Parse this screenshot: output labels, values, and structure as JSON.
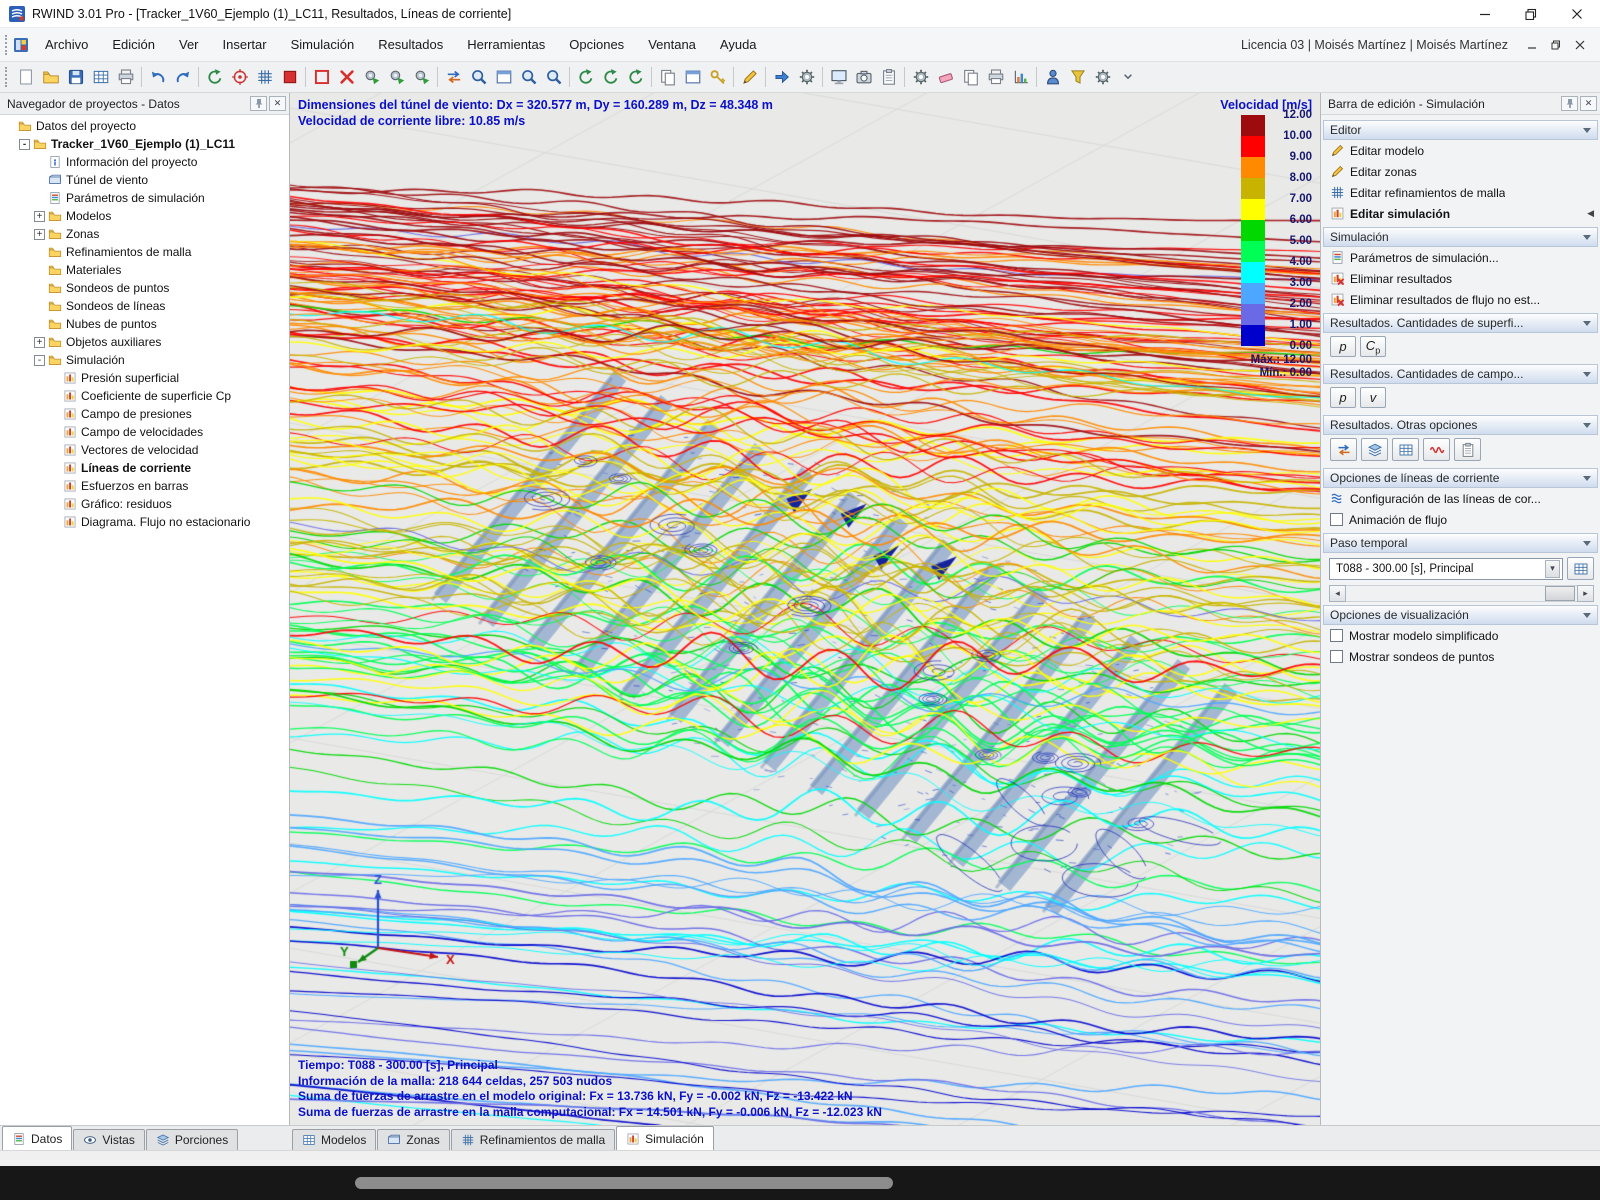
{
  "window": {
    "title": "RWIND 3.01 Pro - [Tracker_1V60_Ejemplo (1)_LC11, Resultados, Líneas de corriente]",
    "license": "Licencia 03 | Moisés Martínez | Moisés Martínez"
  },
  "menu": {
    "items": [
      "Archivo",
      "Edición",
      "Ver",
      "Insertar",
      "Simulación",
      "Resultados",
      "Herramientas",
      "Opciones",
      "Ventana",
      "Ayuda"
    ]
  },
  "toolbar": {
    "items": [
      {
        "name": "new-project",
        "kind": "page"
      },
      {
        "name": "open-project",
        "kind": "folder"
      },
      {
        "name": "save-project",
        "kind": "floppy"
      },
      {
        "name": "project-tables",
        "kind": "grid"
      },
      {
        "name": "print",
        "kind": "printer"
      },
      {
        "sep": true
      },
      {
        "name": "undo",
        "kind": "undo"
      },
      {
        "name": "redo",
        "kind": "redo"
      },
      {
        "sep": true
      },
      {
        "name": "regenerate-model",
        "kind": "rotate"
      },
      {
        "name": "center-model",
        "kind": "target"
      },
      {
        "name": "mesh-settings",
        "kind": "mesh"
      },
      {
        "name": "stop-calculation",
        "kind": "stop"
      },
      {
        "sep": true
      },
      {
        "name": "wind-tunnel",
        "kind": "frame"
      },
      {
        "name": "delete-results",
        "kind": "xred"
      },
      {
        "name": "run-simulation",
        "kind": "gearplay"
      },
      {
        "name": "run-mesh",
        "kind": "gearplay"
      },
      {
        "name": "run-batch",
        "kind": "gearplay"
      },
      {
        "sep": true
      },
      {
        "name": "swap-flow-direction",
        "kind": "swap"
      },
      {
        "name": "zoom-extents",
        "kind": "magnifier"
      },
      {
        "name": "zoom-window",
        "kind": "window"
      },
      {
        "name": "zoom-in",
        "kind": "magnifier"
      },
      {
        "name": "zoom-out",
        "kind": "magnifier"
      },
      {
        "sep": true
      },
      {
        "name": "rotate-view",
        "kind": "rotate"
      },
      {
        "name": "orbit-view",
        "kind": "rotate"
      },
      {
        "name": "spin-view",
        "kind": "rotate"
      },
      {
        "sep": true
      },
      {
        "name": "copy-graphic",
        "kind": "docs"
      },
      {
        "name": "new-window",
        "kind": "window"
      },
      {
        "name": "license-settings",
        "kind": "key"
      },
      {
        "sep": true
      },
      {
        "name": "annotate",
        "kind": "pen"
      },
      {
        "sep": true
      },
      {
        "name": "move-mode",
        "kind": "arrow"
      },
      {
        "name": "display-settings",
        "kind": "gear"
      },
      {
        "sep": true
      },
      {
        "name": "full-screen-graphic",
        "kind": "monitor"
      },
      {
        "name": "snapshot",
        "kind": "camera"
      },
      {
        "name": "export-graphic",
        "kind": "clipboard"
      },
      {
        "sep": true
      },
      {
        "name": "configuration",
        "kind": "gear"
      },
      {
        "name": "eraser",
        "kind": "eraser"
      },
      {
        "name": "duplicate",
        "kind": "docs"
      },
      {
        "name": "print-graphic",
        "kind": "printer"
      },
      {
        "name": "result-diagrams",
        "kind": "chart"
      },
      {
        "sep": true
      },
      {
        "name": "edit-user",
        "kind": "person"
      },
      {
        "name": "filter-results",
        "kind": "funnel"
      },
      {
        "name": "customize-toolbar",
        "kind": "gear"
      },
      {
        "name": "toolbar-overflow",
        "kind": "grip"
      }
    ]
  },
  "left_panel": {
    "title": "Navegador de proyectos - Datos",
    "tree": [
      {
        "label": "Datos del proyecto",
        "level": 0,
        "icon": "folder"
      },
      {
        "label": "Tracker_1V60_Ejemplo (1)_LC11",
        "level": 1,
        "icon": "folder",
        "bold": true,
        "expander": "minus"
      },
      {
        "label": "Información del proyecto",
        "level": 2,
        "icon": "info"
      },
      {
        "label": "Túnel de viento",
        "level": 2,
        "icon": "tunnel"
      },
      {
        "label": "Parámetros de simulación",
        "level": 2,
        "icon": "params"
      },
      {
        "label": "Modelos",
        "level": 2,
        "icon": "folder",
        "expander": "plus"
      },
      {
        "label": "Zonas",
        "level": 2,
        "icon": "folder",
        "expander": "plus"
      },
      {
        "label": "Refinamientos de malla",
        "level": 2,
        "icon": "folder"
      },
      {
        "label": "Materiales",
        "level": 2,
        "icon": "folder"
      },
      {
        "label": "Sondeos de puntos",
        "level": 2,
        "icon": "folder"
      },
      {
        "label": "Sondeos de líneas",
        "level": 2,
        "icon": "folder"
      },
      {
        "label": "Nubes de puntos",
        "level": 2,
        "icon": "folder"
      },
      {
        "label": "Objetos auxiliares",
        "level": 2,
        "icon": "folder",
        "expander": "plus"
      },
      {
        "label": "Simulación",
        "level": 2,
        "icon": "folder",
        "expander": "minus"
      },
      {
        "label": "Presión superficial",
        "level": 3,
        "icon": "bars"
      },
      {
        "label": "Coeficiente de superficie Cp",
        "level": 3,
        "icon": "bars"
      },
      {
        "label": "Campo de presiones",
        "level": 3,
        "icon": "bars"
      },
      {
        "label": "Campo de velocidades",
        "level": 3,
        "icon": "bars"
      },
      {
        "label": "Vectores de velocidad",
        "level": 3,
        "icon": "bars"
      },
      {
        "label": "Líneas de corriente",
        "level": 3,
        "icon": "bars",
        "bold": true,
        "selected": true
      },
      {
        "label": "Esfuerzos en barras",
        "level": 3,
        "icon": "bars"
      },
      {
        "label": "Gráfico: residuos",
        "level": 3,
        "icon": "bars"
      },
      {
        "label": "Diagrama. Flujo no estacionario",
        "level": 3,
        "icon": "bars"
      }
    ]
  },
  "viewport": {
    "header_line1": "Dimensiones del túnel de viento: Dx = 320.577 m, Dy = 160.289 m, Dz = 48.348 m",
    "header_line2": "Velocidad de corriente libre: 10.85 m/s",
    "legend": {
      "title": "Velocidad [m/s]",
      "values": [
        "12.00",
        "10.00",
        "9.00",
        "8.00",
        "7.00",
        "6.00",
        "5.00",
        "4.00",
        "3.00",
        "2.00",
        "1.00",
        "0.00"
      ],
      "colors": [
        "#9e0b0f",
        "#ff0000",
        "#ff8a00",
        "#c8b400",
        "#ffff00",
        "#00d800",
        "#00ff55",
        "#00ffff",
        "#4da6ff",
        "#6a6ae6",
        "#0000cd"
      ],
      "max_label": "Máx.: 12.00",
      "min_label": "Mín.: 0.00"
    },
    "footer_lines": [
      "Tiempo: T088 - 300.00 [s], Principal",
      "Información de la malla: 218 644 celdas, 257 503 nudos",
      "Suma de fuerzas de arrastre en el modelo original: Fx = 13.736 kN, Fy = -0.002 kN, Fz = -13.422 kN",
      "Suma de fuerzas de arrastre en la malla computacional: Fx = 14.501 kN, Fy = -0.006 kN, Fz = -12.023 kN"
    ],
    "axes": {
      "x": "X",
      "y": "Y",
      "z": "Z"
    }
  },
  "right_panel": {
    "title": "Barra de edición - Simulación",
    "sections": [
      {
        "title": "Editor",
        "items": [
          {
            "label": "Editar modelo",
            "icon": "pencil"
          },
          {
            "label": "Editar zonas",
            "icon": "pencil"
          },
          {
            "label": "Editar refinamientos de malla",
            "icon": "mesh"
          },
          {
            "label": "Editar simulación",
            "icon": "bars",
            "bold": true,
            "marker": true
          }
        ]
      },
      {
        "title": "Simulación",
        "items": [
          {
            "label": "Parámetros de simulación...",
            "icon": "params"
          },
          {
            "label": "Eliminar resultados",
            "icon": "del-red"
          },
          {
            "label": "Eliminar resultados de flujo no est...",
            "icon": "del-red"
          }
        ]
      },
      {
        "title": "Resultados. Cantidades de superfi...",
        "buttons": [
          {
            "label": "p",
            "name": "surface-pressure-button"
          },
          {
            "label": "Cp",
            "name": "surface-cp-button"
          }
        ]
      },
      {
        "title": "Resultados. Cantidades de campo...",
        "buttons": [
          {
            "label": "p",
            "name": "field-pressure-button"
          },
          {
            "label": "v",
            "name": "field-velocity-button"
          }
        ]
      },
      {
        "title": "Resultados. Otras opciones",
        "iconButtons": [
          {
            "name": "streamline-swap",
            "kind": "swap"
          },
          {
            "name": "section-planes",
            "kind": "layers"
          },
          {
            "name": "result-table",
            "kind": "grid"
          },
          {
            "name": "residual-wave",
            "kind": "wave-red"
          },
          {
            "name": "copy-results",
            "kind": "clipboard"
          }
        ]
      },
      {
        "title": "Opciones de líneas de corriente",
        "items": [
          {
            "label": "Configuración de las líneas de cor...",
            "icon": "stream"
          },
          {
            "label": "Animación de flujo",
            "checkbox": true,
            "checked": false
          }
        ]
      },
      {
        "title": "Paso temporal",
        "timestep": {
          "value": "T088 - 300.00 [s], Principal"
        }
      },
      {
        "title": "Opciones de visualización",
        "items": [
          {
            "label": "Mostrar modelo simplificado",
            "checkbox": true,
            "checked": false
          },
          {
            "label": "Mostrar sondeos de puntos",
            "checkbox": true,
            "checked": false
          }
        ]
      }
    ]
  },
  "bottom_tabs": {
    "left": [
      {
        "label": "Datos",
        "icon": "params",
        "active": true
      },
      {
        "label": "Vistas",
        "icon": "eye"
      },
      {
        "label": "Porciones",
        "icon": "layers"
      }
    ],
    "right": [
      {
        "label": "Modelos",
        "icon": "grid"
      },
      {
        "label": "Zonas",
        "icon": "tunnel"
      },
      {
        "label": "Refinamientos de malla",
        "icon": "mesh"
      },
      {
        "label": "Simulación",
        "icon": "bars",
        "active": true
      }
    ]
  },
  "scene": {
    "background": "#e9eae8",
    "grid_color": "#d9dad8",
    "panel_color": "rgba(151,174,207,0.85)",
    "panel_rows": 14,
    "streamlines": 215,
    "vortices": 17,
    "dashes": 430,
    "loops": 6
  }
}
